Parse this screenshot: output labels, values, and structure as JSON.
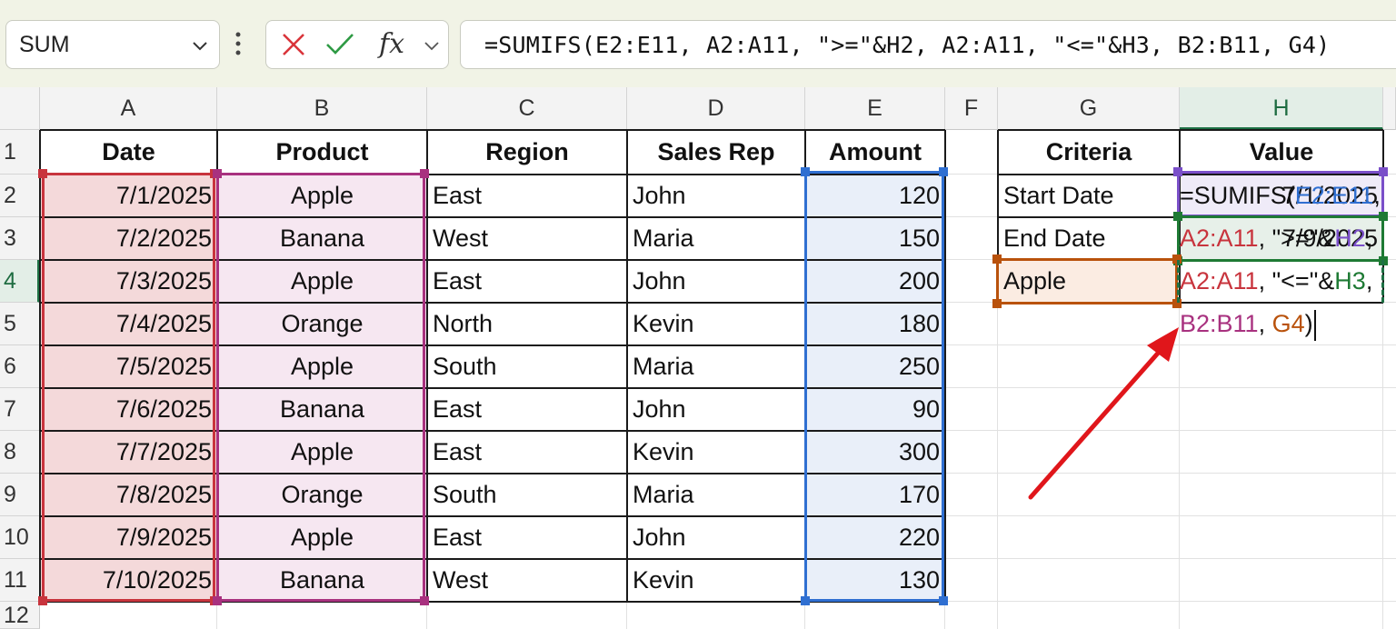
{
  "namebox": {
    "value": "SUM"
  },
  "formula_bar": {
    "cancel_icon": "x-icon",
    "enter_icon": "check-icon",
    "function_icon": "fx",
    "text": "=SUMIFS(E2:E11, A2:A11, \">=\"&H2, A2:A11, \"<=\"&H3, B2:B11, G4)"
  },
  "columns": [
    "A",
    "B",
    "C",
    "D",
    "E",
    "F",
    "G",
    "H"
  ],
  "rows": [
    "1",
    "2",
    "3",
    "4",
    "5",
    "6",
    "7",
    "8",
    "9",
    "10",
    "11",
    "12"
  ],
  "selected_column": "H",
  "selected_row": "4",
  "headers": {
    "A": "Date",
    "B": "Product",
    "C": "Region",
    "D": "Sales Rep",
    "E": "Amount",
    "G": "Criteria",
    "H": "Value"
  },
  "table": [
    [
      "7/1/2025",
      "Apple",
      "East",
      "John",
      "120"
    ],
    [
      "7/2/2025",
      "Banana",
      "West",
      "Maria",
      "150"
    ],
    [
      "7/3/2025",
      "Apple",
      "East",
      "John",
      "200"
    ],
    [
      "7/4/2025",
      "Orange",
      "North",
      "Kevin",
      "180"
    ],
    [
      "7/5/2025",
      "Apple",
      "South",
      "Maria",
      "250"
    ],
    [
      "7/6/2025",
      "Banana",
      "East",
      "John",
      "90"
    ],
    [
      "7/7/2025",
      "Apple",
      "East",
      "Kevin",
      "300"
    ],
    [
      "7/8/2025",
      "Orange",
      "South",
      "Maria",
      "170"
    ],
    [
      "7/9/2025",
      "Apple",
      "East",
      "John",
      "220"
    ],
    [
      "7/10/2025",
      "Banana",
      "West",
      "Kevin",
      "130"
    ]
  ],
  "criteria": [
    {
      "label": "Start Date",
      "value": "7/1/2025"
    },
    {
      "label": "End Date",
      "value": "7/9/2025"
    },
    {
      "label": "Apple"
    }
  ],
  "edit_formula": {
    "p1": "=SUMIFS(",
    "r1": "E2:E11",
    "s1": ", ",
    "r2": "A2:A11",
    "s2": ", \">=\"&",
    "r3": "H2",
    "s3": ", ",
    "r4": "A2:A11",
    "s4": ", \"<=\"&",
    "r5": "H3",
    "s5": ", ",
    "r6": "B2:B11",
    "s6": ", ",
    "r7": "G4",
    "p2": ")"
  },
  "colors": {
    "range_amount": "#2f6fd1",
    "range_date": "#c8343d",
    "range_product": "#a8317f",
    "range_h2": "#7a4fc9",
    "range_h3": "#1e7a34",
    "range_g4": "#b9520c",
    "arrow": "#e0161b",
    "selection": "#1e7145"
  }
}
